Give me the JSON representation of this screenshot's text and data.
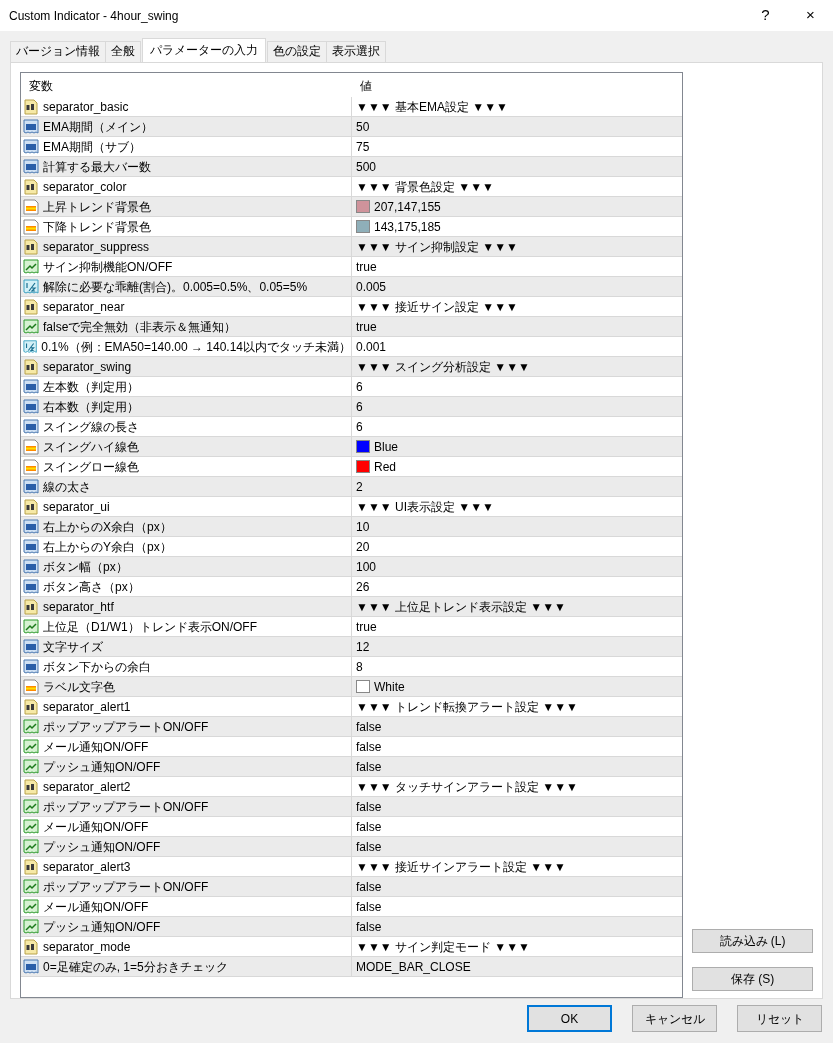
{
  "window": {
    "title": "Custom Indicator - 4hour_swing",
    "buttons": [
      "?",
      "×"
    ]
  },
  "tabs": [
    {
      "label": "バージョン情報",
      "selected": false
    },
    {
      "label": "全般",
      "selected": false
    },
    {
      "label": "パラメーターの入力",
      "selected": true
    },
    {
      "label": "色の設定",
      "selected": false
    },
    {
      "label": "表示選択",
      "selected": false
    }
  ],
  "table": {
    "columns": [
      "変数",
      "値"
    ],
    "rows": [
      {
        "kind": "string",
        "name": "separator_basic",
        "value": "▼▼▼ 基本EMA設定 ▼▼▼"
      },
      {
        "kind": "int",
        "name": "EMA期間（メイン）",
        "value": "50"
      },
      {
        "kind": "int",
        "name": "EMA期間（サブ）",
        "value": "75"
      },
      {
        "kind": "int",
        "name": "計算する最大バー数",
        "value": "500"
      },
      {
        "kind": "string",
        "name": "separator_color",
        "value": "▼▼▼ 背景色設定 ▼▼▼"
      },
      {
        "kind": "color",
        "name": "上昇トレンド背景色",
        "value": "207,147,155",
        "color": "#cf939b"
      },
      {
        "kind": "color",
        "name": "下降トレンド背景色",
        "value": "143,175,185",
        "color": "#8fafb9"
      },
      {
        "kind": "string",
        "name": "separator_suppress",
        "value": "▼▼▼ サイン抑制設定 ▼▼▼"
      },
      {
        "kind": "bool",
        "name": "サイン抑制機能ON/OFF",
        "value": "true"
      },
      {
        "kind": "double",
        "name": "解除に必要な乖離(割合)。0.005=0.5%、0.05=5%",
        "value": "0.005"
      },
      {
        "kind": "string",
        "name": "separator_near",
        "value": "▼▼▼ 接近サイン設定 ▼▼▼"
      },
      {
        "kind": "bool",
        "name": "falseで完全無効（非表示＆無通知）",
        "value": "true"
      },
      {
        "kind": "double",
        "name": "0.1%（例：EMA50=140.00 → 140.14以内でタッチ未満）",
        "value": "0.001"
      },
      {
        "kind": "string",
        "name": "separator_swing",
        "value": "▼▼▼ スイング分析設定 ▼▼▼"
      },
      {
        "kind": "int",
        "name": "左本数（判定用）",
        "value": "6"
      },
      {
        "kind": "int",
        "name": "右本数（判定用）",
        "value": "6"
      },
      {
        "kind": "int",
        "name": "スイング線の長さ",
        "value": "6"
      },
      {
        "kind": "color",
        "name": "スイングハイ線色",
        "value": "Blue",
        "color": "#0000ff"
      },
      {
        "kind": "color",
        "name": "スイングロー線色",
        "value": "Red",
        "color": "#ff0000"
      },
      {
        "kind": "int",
        "name": "線の太さ",
        "value": "2"
      },
      {
        "kind": "string",
        "name": "separator_ui",
        "value": "▼▼▼ UI表示設定 ▼▼▼"
      },
      {
        "kind": "int",
        "name": "右上からのX余白（px）",
        "value": "10"
      },
      {
        "kind": "int",
        "name": "右上からのY余白（px）",
        "value": "20"
      },
      {
        "kind": "int",
        "name": "ボタン幅（px）",
        "value": "100"
      },
      {
        "kind": "int",
        "name": "ボタン高さ（px）",
        "value": "26"
      },
      {
        "kind": "string",
        "name": "separator_htf",
        "value": "▼▼▼ 上位足トレンド表示設定 ▼▼▼"
      },
      {
        "kind": "bool",
        "name": "上位足（D1/W1）トレンド表示ON/OFF",
        "value": "true"
      },
      {
        "kind": "int",
        "name": "文字サイズ",
        "value": "12"
      },
      {
        "kind": "int",
        "name": "ボタン下からの余白",
        "value": "8"
      },
      {
        "kind": "color",
        "name": "ラベル文字色",
        "value": "White",
        "color": "#ffffff"
      },
      {
        "kind": "string",
        "name": "separator_alert1",
        "value": "▼▼▼ トレンド転換アラート設定 ▼▼▼"
      },
      {
        "kind": "bool",
        "name": "ポップアップアラートON/OFF",
        "value": "false"
      },
      {
        "kind": "bool",
        "name": "メール通知ON/OFF",
        "value": "false"
      },
      {
        "kind": "bool",
        "name": "プッシュ通知ON/OFF",
        "value": "false"
      },
      {
        "kind": "string",
        "name": "separator_alert2",
        "value": "▼▼▼ タッチサインアラート設定 ▼▼▼"
      },
      {
        "kind": "bool",
        "name": "ポップアップアラートON/OFF",
        "value": "false"
      },
      {
        "kind": "bool",
        "name": "メール通知ON/OFF",
        "value": "false"
      },
      {
        "kind": "bool",
        "name": "プッシュ通知ON/OFF",
        "value": "false"
      },
      {
        "kind": "string",
        "name": "separator_alert3",
        "value": "▼▼▼ 接近サインアラート設定 ▼▼▼"
      },
      {
        "kind": "bool",
        "name": "ポップアップアラートON/OFF",
        "value": "false"
      },
      {
        "kind": "bool",
        "name": "メール通知ON/OFF",
        "value": "false"
      },
      {
        "kind": "bool",
        "name": "プッシュ通知ON/OFF",
        "value": "false"
      },
      {
        "kind": "string",
        "name": "separator_mode",
        "value": "▼▼▼ サイン判定モード ▼▼▼"
      },
      {
        "kind": "int",
        "name": "0=足確定のみ, 1=5分おきチェック",
        "value": "MODE_BAR_CLOSE"
      }
    ]
  },
  "side_buttons": [
    "読み込み (L)",
    "保存 (S)"
  ],
  "footer_buttons": [
    {
      "label": "OK",
      "default": true
    },
    {
      "label": "キャンセル",
      "default": false
    },
    {
      "label": "リセット",
      "default": false
    }
  ]
}
